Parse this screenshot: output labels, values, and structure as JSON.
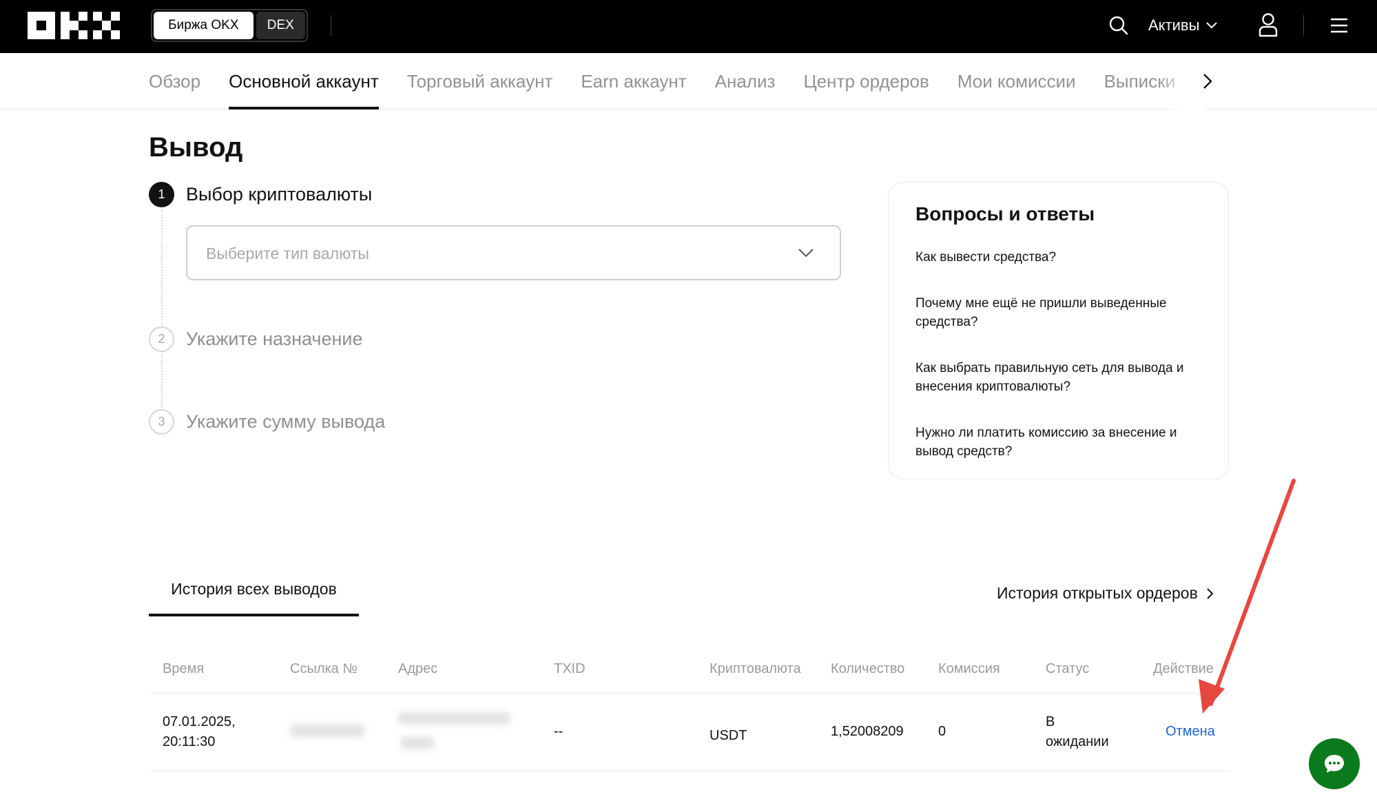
{
  "header": {
    "brand": "OKX",
    "switch": {
      "exchange_label": "Биржа OKX",
      "dex_label": "DEX"
    },
    "assets_label": "Активы"
  },
  "subnav": {
    "tabs": [
      {
        "label": "Обзор"
      },
      {
        "label": "Основной аккаунт"
      },
      {
        "label": "Торговый аккаунт"
      },
      {
        "label": "Earn аккаунт"
      },
      {
        "label": "Анализ"
      },
      {
        "label": "Центр ордеров"
      },
      {
        "label": "Мои комиссии"
      },
      {
        "label": "Выписки"
      }
    ],
    "active_index": 1
  },
  "withdraw": {
    "title": "Вывод",
    "steps": [
      {
        "num": "1",
        "label": "Выбор криптовалюты"
      },
      {
        "num": "2",
        "label": "Укажите назначение"
      },
      {
        "num": "3",
        "label": "Укажите сумму вывода"
      }
    ],
    "currency_select": {
      "placeholder": "Выберите тип валюты"
    }
  },
  "faq": {
    "title": "Вопросы и ответы",
    "questions": [
      "Как вывести средства?",
      "Почему мне ещё не пришли выведенные средства?",
      "Как выбрать правильную сеть для вывода и внесения криптовалюты?",
      "Нужно ли платить комиссию за внесение и вывод средств?"
    ]
  },
  "history": {
    "tab_label": "История всех выводов",
    "open_orders_label": "История открытых ордеров",
    "columns": [
      "Время",
      "Ссылка №",
      "Адрес",
      "TXID",
      "Криптовалюта",
      "Количество",
      "Комиссия",
      "Статус",
      "Действие"
    ],
    "rows": [
      {
        "time_date": "07.01.2025,",
        "time_clock": "20:11:30",
        "txid": "--",
        "currency": "USDT",
        "amount": "1,52008209",
        "fee": "0",
        "status_line1": "В",
        "status_line2": "ожидании",
        "action": "Отмена"
      }
    ]
  },
  "colors": {
    "topbar_bg": "#000000",
    "text_primary": "#121212",
    "text_muted": "#929292",
    "link_blue": "#1e64d8",
    "annotation_arrow": "#e8473f",
    "chat_button": "#0b7a1c"
  }
}
